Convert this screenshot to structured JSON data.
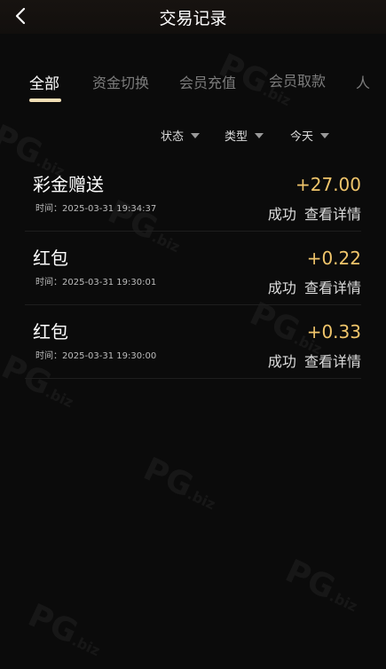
{
  "header": {
    "title": "交易记录"
  },
  "tabs": [
    {
      "label": "全部"
    },
    {
      "label": "资金切换"
    },
    {
      "label": "会员充值"
    },
    {
      "label": "会员取款"
    },
    {
      "label": "人"
    }
  ],
  "filters": [
    {
      "label": "状态"
    },
    {
      "label": "类型"
    },
    {
      "label": "今天"
    }
  ],
  "transactions": [
    {
      "title": "彩金赠送",
      "time": "时间：2025-03-31 19:34:37",
      "amount": "+27.00",
      "status": "成功",
      "action": "查看详情"
    },
    {
      "title": "红包",
      "time": "时间：2025-03-31 19:30:01",
      "amount": "+0.22",
      "status": "成功",
      "action": "查看详情"
    },
    {
      "title": "红包",
      "time": "时间：2025-03-31 19:30:00",
      "amount": "+0.33",
      "status": "成功",
      "action": "查看详情"
    }
  ],
  "watermark": {
    "text": "PG",
    "suffix": ".biz"
  },
  "colors": {
    "accent": "#f2dfb6",
    "amount": "#f0c56b",
    "background": "#0b0b0b"
  }
}
